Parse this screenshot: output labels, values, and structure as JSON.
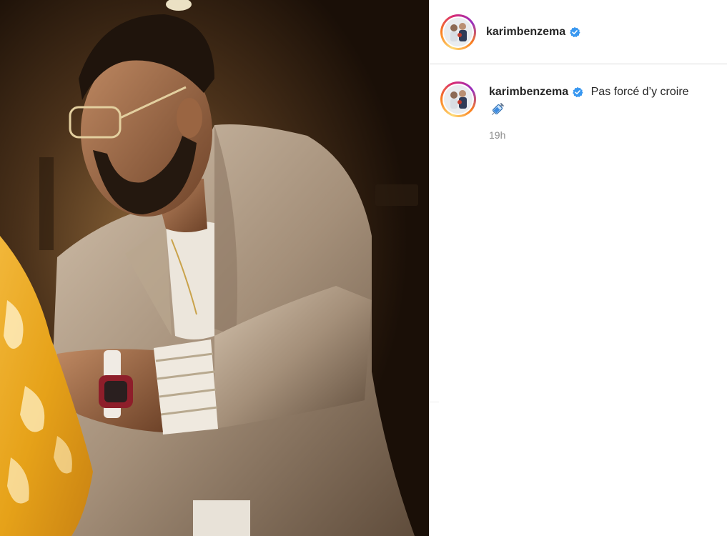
{
  "post": {
    "author": {
      "username": "karimbenzema",
      "verified": true,
      "avatar_icon": "profile-photo-icon",
      "verified_icon": "verified-badge-icon"
    },
    "caption": {
      "username": "karimbenzema",
      "text": "Pas forcé d’y croire",
      "emoji": "syringe-emoji",
      "time": "19h"
    }
  },
  "colors": {
    "verified_blue": "#3897f0",
    "text_primary": "#262626",
    "text_secondary": "#8e8e8e",
    "divider": "#dbdbdb"
  }
}
